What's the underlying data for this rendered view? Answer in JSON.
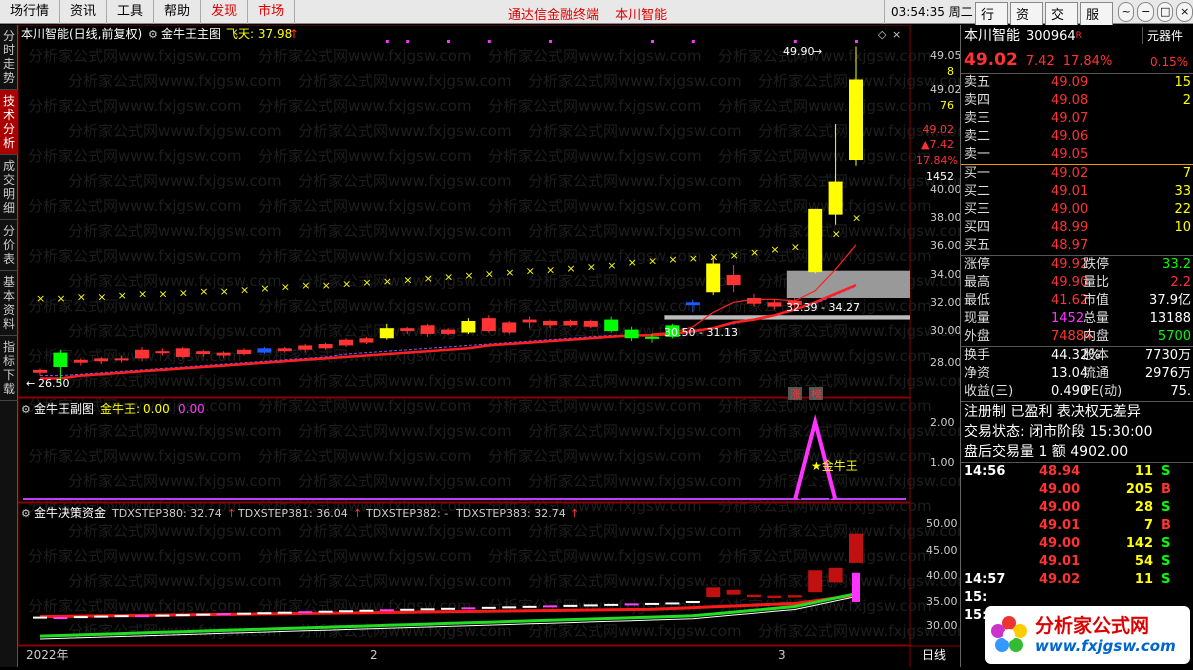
{
  "menu": {
    "items": [
      "场行情",
      "资讯",
      "工具",
      "帮助"
    ],
    "red_items": [
      "发现",
      "市场"
    ]
  },
  "ticker": {
    "left": "通达信金融终端",
    "right": "本川智能"
  },
  "clock": "03:54:35 周二",
  "right_buttons": [
    "行情",
    "资讯",
    "交易",
    "服务"
  ],
  "window_buttons": [
    "~",
    "−",
    "□",
    "×"
  ],
  "sidebar": [
    "分时走势",
    "技术分析",
    "成交明细",
    "分价表",
    "基本资料",
    "指标下载"
  ],
  "main": {
    "title": "本川智能(日线,前复权)",
    "indicator": "金牛王主图",
    "feitian": "飞天: 37.98",
    "high_label": "49.90",
    "low_label": "26.50",
    "range1": "30.50 - 31.13",
    "range2": "32.39 - 34.27",
    "zhang": "涨",
    "bang": "榜",
    "yaxis": [
      "49.05",
      "8",
      "49.02",
      "76",
      "49.02",
      "▲7.42",
      "17.84%",
      "1452",
      "40.00",
      "38.00",
      "36.00",
      "34.00",
      "32.00",
      "30.00",
      "28.00"
    ]
  },
  "sub1": {
    "title": "金牛王副图",
    "name": "金牛王:",
    "val1": "0.00",
    "val2": "0.00",
    "star_label": "★金牛王",
    "yaxis": [
      "2.00",
      "1.00"
    ]
  },
  "sub2": {
    "title": "金牛决策资金",
    "l1": "TDXSTEP380: 32.74",
    "l2": "TDXSTEP381: 36.04",
    "l3": "TDXSTEP382: -",
    "l4": "TDXSTEP383: 32.74",
    "yaxis": [
      "50.00",
      "45.00",
      "40.00",
      "35.00",
      "30.00"
    ]
  },
  "xaxis": {
    "a": "2022年",
    "b": "2",
    "c": "3",
    "period": "日线"
  },
  "quote": {
    "name": "本川智能",
    "code": "300964",
    "r": "R",
    "tag": "元器件",
    "tag_pct": "0.15%",
    "price": "49.02",
    "chg": "7.42",
    "pct": "17.84%"
  },
  "asks": [
    {
      "l": "卖五",
      "p": "49.09",
      "q": "15"
    },
    {
      "l": "卖四",
      "p": "49.08",
      "q": "2"
    },
    {
      "l": "卖三",
      "p": "49.07",
      "q": ""
    },
    {
      "l": "卖二",
      "p": "49.06",
      "q": ""
    },
    {
      "l": "卖一",
      "p": "49.05",
      "q": ""
    }
  ],
  "bids": [
    {
      "l": "买一",
      "p": "49.02",
      "q": "7"
    },
    {
      "l": "买二",
      "p": "49.01",
      "q": "33"
    },
    {
      "l": "买三",
      "p": "49.00",
      "q": "22"
    },
    {
      "l": "买四",
      "p": "48.99",
      "q": "10"
    },
    {
      "l": "买五",
      "p": "48.97",
      "q": ""
    }
  ],
  "stats1": [
    {
      "l": "涨停",
      "v": "49.92",
      "l2": "跌停",
      "v2": "33.2"
    },
    {
      "l": "最高",
      "v": "49.90",
      "l2": "量比",
      "v2": "2.2"
    },
    {
      "l": "最低",
      "v": "41.62",
      "l2": "市值",
      "v2": "37.9亿"
    },
    {
      "l": "现量",
      "v": "1452",
      "l2": "总量",
      "v2": "13188"
    },
    {
      "l": "外盘",
      "v": "74884",
      "l2": "内盘",
      "v2": "5700"
    }
  ],
  "stats2": [
    {
      "l": "换手",
      "v": "44.32%",
      "l2": "股本",
      "v2": "7730万"
    },
    {
      "l": "净资",
      "v": "13.04",
      "l2": "流通",
      "v2": "2976万"
    },
    {
      "l": "收益(三)",
      "v": "0.490",
      "l2": "PE(动)",
      "v2": "75."
    }
  ],
  "info": [
    "注册制 已盈利 表决权无差异",
    "交易状态: 闭市阶段 15:30:00",
    "盘后交易量 1 额 4902.00"
  ],
  "ticks": [
    {
      "t": "14:56",
      "p": "48.94",
      "n": "11",
      "s": "S"
    },
    {
      "t": "",
      "p": "49.00",
      "n": "205",
      "s": "B"
    },
    {
      "t": "",
      "p": "49.00",
      "n": "28",
      "s": "S"
    },
    {
      "t": "",
      "p": "49.01",
      "n": "7",
      "s": "B"
    },
    {
      "t": "",
      "p": "49.00",
      "n": "142",
      "s": "S"
    },
    {
      "t": "",
      "p": "49.01",
      "n": "54",
      "s": "S"
    },
    {
      "t": "14:57",
      "p": "49.02",
      "n": "11",
      "s": "S"
    },
    {
      "t": "15:",
      "p": "",
      "n": "",
      "s": ""
    },
    {
      "t": "15:",
      "p": "",
      "n": "",
      "s": ""
    }
  ],
  "logo": {
    "t1": "分析家公式网",
    "t2": "www.fxjgsw.com"
  },
  "watermark": "分析家公式网www.fxjgsw.com",
  "colors": {
    "up": "#ff3333",
    "down": "#00ff00",
    "yellow": "#ffff00",
    "magenta": "#ff33ff"
  },
  "chart_data": {
    "type": "candlestick",
    "ylim": [
      25,
      50
    ],
    "candles": [
      {
        "o": 27.2,
        "h": 27.5,
        "c": 27.4,
        "l": 27.0,
        "col": "red"
      },
      {
        "o": 28.6,
        "h": 28.8,
        "c": 27.6,
        "l": 26.5,
        "col": "green"
      },
      {
        "o": 27.9,
        "h": 28.2,
        "c": 28.1,
        "l": 27.7,
        "col": "red"
      },
      {
        "o": 28.0,
        "h": 28.3,
        "c": 28.2,
        "l": 27.8,
        "col": "red"
      },
      {
        "o": 28.1,
        "h": 28.4,
        "c": 28.2,
        "l": 27.9,
        "col": "red"
      },
      {
        "o": 28.2,
        "h": 29.0,
        "c": 28.8,
        "l": 28.0,
        "col": "red"
      },
      {
        "o": 28.6,
        "h": 28.9,
        "c": 28.7,
        "l": 28.4,
        "col": "red"
      },
      {
        "o": 28.3,
        "h": 29.0,
        "c": 28.9,
        "l": 28.2,
        "col": "red"
      },
      {
        "o": 28.5,
        "h": 28.8,
        "c": 28.7,
        "l": 28.3,
        "col": "red"
      },
      {
        "o": 28.4,
        "h": 28.7,
        "c": 28.6,
        "l": 28.2,
        "col": "red"
      },
      {
        "o": 28.5,
        "h": 28.9,
        "c": 28.8,
        "l": 28.4,
        "col": "red"
      },
      {
        "o": 28.6,
        "h": 29.0,
        "c": 28.9,
        "l": 28.5,
        "col": "blue"
      },
      {
        "o": 28.7,
        "h": 29.0,
        "c": 28.9,
        "l": 28.6,
        "col": "red"
      },
      {
        "o": 28.8,
        "h": 29.2,
        "c": 29.1,
        "l": 28.6,
        "col": "red"
      },
      {
        "o": 28.9,
        "h": 29.3,
        "c": 29.2,
        "l": 28.8,
        "col": "red"
      },
      {
        "o": 29.1,
        "h": 29.6,
        "c": 29.5,
        "l": 29.0,
        "col": "red"
      },
      {
        "o": 29.3,
        "h": 29.7,
        "c": 29.6,
        "l": 29.2,
        "col": "red"
      },
      {
        "o": 30.3,
        "h": 30.6,
        "c": 29.6,
        "l": 29.5,
        "col": "yellow"
      },
      {
        "o": 30.1,
        "h": 30.4,
        "c": 30.3,
        "l": 29.9,
        "col": "red"
      },
      {
        "o": 29.9,
        "h": 30.6,
        "c": 30.5,
        "l": 29.7,
        "col": "red"
      },
      {
        "o": 29.9,
        "h": 30.3,
        "c": 30.2,
        "l": 29.8,
        "col": "red"
      },
      {
        "o": 30.8,
        "h": 31.0,
        "c": 30.0,
        "l": 29.9,
        "col": "yellow"
      },
      {
        "o": 30.1,
        "h": 31.2,
        "c": 31.0,
        "l": 30.0,
        "col": "red"
      },
      {
        "o": 30.0,
        "h": 30.8,
        "c": 30.7,
        "l": 29.9,
        "col": "red"
      },
      {
        "o": 30.7,
        "h": 31.1,
        "c": 30.9,
        "l": 30.3,
        "col": "red"
      },
      {
        "o": 30.5,
        "h": 30.9,
        "c": 30.8,
        "l": 30.3,
        "col": "red"
      },
      {
        "o": 30.5,
        "h": 30.9,
        "c": 30.8,
        "l": 30.4,
        "col": "red"
      },
      {
        "o": 30.4,
        "h": 30.9,
        "c": 30.8,
        "l": 30.3,
        "col": "red"
      },
      {
        "o": 30.1,
        "h": 31.1,
        "c": 30.9,
        "l": 30.0,
        "col": "green"
      },
      {
        "o": 30.2,
        "h": 30.4,
        "c": 29.6,
        "l": 29.4,
        "col": "green"
      },
      {
        "o": 29.6,
        "h": 29.9,
        "c": 29.7,
        "l": 29.3,
        "col": "green"
      },
      {
        "o": 29.7,
        "h": 30.6,
        "c": 30.5,
        "l": 29.6,
        "col": "green"
      },
      {
        "o": 31.9,
        "h": 32.3,
        "c": 32.1,
        "l": 31.4,
        "col": "blue"
      },
      {
        "o": 32.8,
        "h": 35.3,
        "c": 34.8,
        "l": 32.6,
        "col": "yellow"
      },
      {
        "o": 33.3,
        "h": 34.7,
        "c": 34.0,
        "l": 32.8,
        "col": "red"
      },
      {
        "o": 32.0,
        "h": 32.7,
        "c": 32.4,
        "l": 31.8,
        "col": "red"
      },
      {
        "o": 31.8,
        "h": 32.3,
        "c": 32.1,
        "l": 31.6,
        "col": "red"
      },
      {
        "o": 31.9,
        "h": 32.4,
        "c": 32.2,
        "l": 31.7,
        "col": "red"
      },
      {
        "o": 34.2,
        "h": 38.6,
        "c": 38.6,
        "l": 34.1,
        "col": "yellow"
      },
      {
        "o": 38.2,
        "h": 44.5,
        "c": 40.5,
        "l": 37.5,
        "col": "yellow"
      },
      {
        "o": 42.0,
        "h": 49.9,
        "c": 47.6,
        "l": 41.6,
        "col": "yellow"
      }
    ],
    "ma_red": [
      26.8,
      26.8,
      27.0,
      27.1,
      27.2,
      27.3,
      27.4,
      27.5,
      27.6,
      27.7,
      27.8,
      27.9,
      28.0,
      28.1,
      28.2,
      28.3,
      28.4,
      28.5,
      28.6,
      28.7,
      28.8,
      28.9,
      29.1,
      29.2,
      29.3,
      29.4,
      29.5,
      29.6,
      29.7,
      29.8,
      29.8,
      29.9,
      30.1,
      30.3,
      30.7,
      30.9,
      31.2,
      31.6,
      32.1,
      32.7,
      33.3
    ],
    "ma_purple": [
      27.0,
      27.0,
      27.1,
      27.2,
      27.3,
      27.4,
      27.5,
      27.6,
      27.7,
      27.8,
      27.9,
      28.0,
      28.1,
      28.2,
      28.3,
      28.5,
      28.6,
      28.7,
      28.8,
      28.9,
      29.0,
      29.1,
      29.2,
      29.3,
      29.4,
      29.5,
      29.6,
      29.7,
      29.8,
      29.8,
      29.8,
      29.9,
      30.0,
      30.3,
      30.6,
      30.9,
      31.2,
      31.6,
      32.0,
      32.6,
      33.2
    ],
    "ma_short": [
      null,
      null,
      null,
      null,
      null,
      null,
      null,
      null,
      null,
      null,
      null,
      null,
      null,
      null,
      null,
      null,
      null,
      null,
      null,
      null,
      null,
      null,
      null,
      null,
      null,
      null,
      null,
      null,
      null,
      null,
      29.9,
      30.0,
      30.4,
      31.4,
      32.1,
      32.3,
      32.3,
      32.2,
      32.9,
      34.4,
      36.1
    ],
    "sar": [
      32.4,
      32.4,
      32.5,
      32.5,
      32.6,
      32.7,
      32.7,
      32.8,
      32.9,
      32.9,
      33.0,
      33.1,
      33.2,
      33.3,
      33.3,
      33.4,
      33.5,
      33.6,
      33.7,
      33.8,
      33.9,
      34.0,
      34.1,
      34.2,
      34.3,
      34.4,
      34.5,
      34.6,
      34.7,
      34.9,
      35.0,
      35.1,
      35.2,
      35.3,
      35.4,
      35.6,
      35.8,
      36.0,
      36.3,
      36.9,
      38.0
    ],
    "sub1_peak_index": 38,
    "sub2_bars": [
      {
        "o": 31.6,
        "c": 32.0
      },
      {
        "o": 31.5,
        "c": 31.9
      },
      {
        "o": 31.7,
        "c": 32.1
      },
      {
        "o": 31.8,
        "c": 32.2
      },
      {
        "o": 31.9,
        "c": 32.3
      },
      {
        "o": 32.0,
        "c": 32.3
      },
      {
        "o": 32.1,
        "c": 32.4
      },
      {
        "o": 32.2,
        "c": 32.5
      },
      {
        "o": 32.3,
        "c": 32.6
      },
      {
        "o": 32.4,
        "c": 32.7
      },
      {
        "o": 32.5,
        "c": 32.8
      },
      {
        "o": 32.6,
        "c": 32.9
      },
      {
        "o": 32.7,
        "c": 33.0
      },
      {
        "o": 32.8,
        "c": 33.1
      },
      {
        "o": 32.9,
        "c": 33.2
      },
      {
        "o": 33.0,
        "c": 33.3
      },
      {
        "o": 33.1,
        "c": 33.4
      },
      {
        "o": 33.2,
        "c": 33.5
      },
      {
        "o": 33.3,
        "c": 33.6
      },
      {
        "o": 33.4,
        "c": 33.7
      },
      {
        "o": 33.5,
        "c": 33.8
      },
      {
        "o": 33.6,
        "c": 33.9
      },
      {
        "o": 33.7,
        "c": 34.0
      },
      {
        "o": 33.8,
        "c": 34.1
      },
      {
        "o": 33.9,
        "c": 34.2
      },
      {
        "o": 34.0,
        "c": 34.3
      },
      {
        "o": 34.1,
        "c": 34.4
      },
      {
        "o": 34.2,
        "c": 34.5
      },
      {
        "o": 34.3,
        "c": 34.6
      },
      {
        "o": 34.4,
        "c": 34.7
      },
      {
        "o": 34.5,
        "c": 34.8
      },
      {
        "o": 34.6,
        "c": 34.9
      },
      {
        "o": 34.8,
        "c": 35.2
      },
      {
        "o": 36.0,
        "c": 38.0
      },
      {
        "o": 36.5,
        "c": 37.5
      },
      {
        "o": 36.0,
        "c": 36.5
      },
      {
        "o": 35.8,
        "c": 36.3
      },
      {
        "o": 35.9,
        "c": 36.4
      },
      {
        "o": 37.0,
        "c": 41.5
      },
      {
        "o": 39.0,
        "c": 42.0
      },
      {
        "o": 43.0,
        "c": 49.0
      }
    ]
  }
}
